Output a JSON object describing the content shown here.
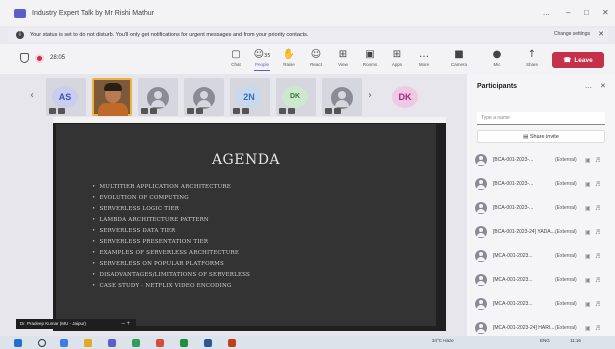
{
  "window": {
    "title": "Industry Expert Talk by Mr Rishi Mathur",
    "controls": [
      "...",
      "–",
      "□",
      "✕"
    ]
  },
  "banner": {
    "message": "Your status is set to do not disturb. You'll only get notifications for urgent messages and from your priority contacts.",
    "action": "Change settings",
    "close": "✕"
  },
  "toolbar": {
    "timer": "28:05",
    "buttons": [
      {
        "label": "Chat",
        "icon": "▢"
      },
      {
        "label": "People",
        "icon": "☺",
        "badge": "35"
      },
      {
        "label": "Raise",
        "icon": "✋"
      },
      {
        "label": "React",
        "icon": "☺"
      },
      {
        "label": "View",
        "icon": "⊞"
      },
      {
        "label": "Rooms",
        "icon": "▣"
      },
      {
        "label": "Apps",
        "icon": "⊞"
      },
      {
        "label": "More",
        "icon": "…"
      },
      {
        "label": "Camera",
        "icon": "■"
      },
      {
        "label": "Mic",
        "icon": "●"
      },
      {
        "label": "Share",
        "icon": "↑"
      }
    ],
    "leave": "Leave"
  },
  "strip": {
    "tiles": [
      {
        "initials": "AS",
        "color": "#3f51b5",
        "bg": "#c9cdf0"
      },
      {
        "photo": true,
        "name": ""
      },
      {
        "initials": ""
      },
      {
        "initials": "2N",
        "color": "#3a6fb0",
        "bg": "#c8d8ee"
      },
      {
        "initials": "DK",
        "color": "#2e7d32",
        "bg": "#cfe6cf"
      },
      {
        "initials": ""
      },
      {
        "initials": "DK",
        "color": "#a0287c",
        "bg": "#efc9e3"
      }
    ]
  },
  "slide": {
    "title": "AGENDA",
    "items": [
      "MULTITIER APPLICATION ARCHITECTURE",
      "EVOLUTION OF COMPUTING",
      "SERVERLESS LOGIC TIER",
      "LAMBDA ARCHITECTURE PATTERN",
      "SERVERLESS DATA TIER",
      "SERVERLESS PRESENTATION TIER",
      "EXAMPLES OF SERVERLESS ARCHITECTURE",
      "SERVERLESS ON POPULAR PLATFORMS",
      "DISADVANTAGES/LIMITATIONS OF SERVERLESS",
      "CASE STUDY - NETFLIX VIDEO ENCODING"
    ],
    "presenter": "Dr. Pradeep Kumar (MU - Jaipur)"
  },
  "participants": {
    "title": "Participants",
    "search_placeholder": "Type a name",
    "share_invite": "Share invite",
    "list": [
      {
        "name": "[BCA-001-2023-...",
        "tag": "(External)"
      },
      {
        "name": "[BCA-001-2023-...",
        "tag": "(External)"
      },
      {
        "name": "[BCA-001-2023-...",
        "tag": "(External)"
      },
      {
        "name": "[BCA-001-2023-24] YADA...",
        "tag": "(External)"
      },
      {
        "name": "[MCA-001-2023...",
        "tag": "(External)"
      },
      {
        "name": "[MCA-001-2023...",
        "tag": "(External)"
      },
      {
        "name": "[MCA-001-2023...",
        "tag": "(External)"
      },
      {
        "name": "[MCA-001-2023...",
        "tag": "(External)"
      },
      {
        "name": "[MCA-001-2023-24] HARI...",
        "tag": "(External)"
      }
    ]
  },
  "taskbar": {
    "weather": "34°C Haze",
    "lang": "ENG",
    "time": "11:16"
  }
}
